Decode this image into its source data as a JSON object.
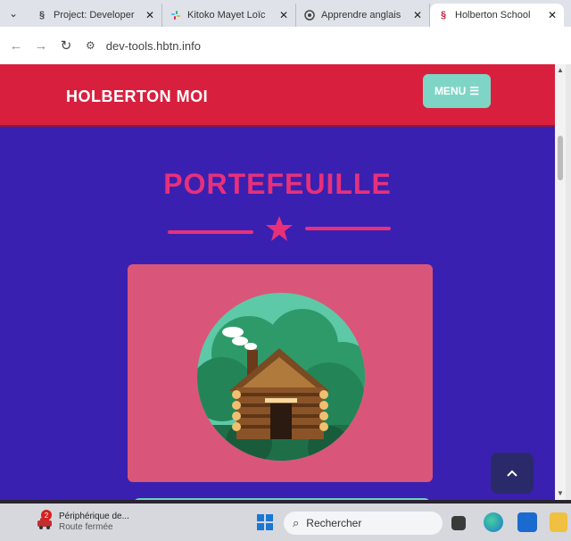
{
  "tabs": [
    {
      "title": "Project: Developer",
      "active": false
    },
    {
      "title": "Kitoko Mayet Loïc",
      "active": false
    },
    {
      "title": "Apprendre anglais",
      "active": false
    },
    {
      "title": "Holberton School",
      "active": true
    }
  ],
  "browser": {
    "url": "dev-tools.hbtn.info",
    "tab_list_icon": "chevron-down-icon"
  },
  "site": {
    "brand": "HOLBERTON MOI",
    "menu_label": "MENU",
    "section_title": "PORTEFEUILLE"
  },
  "taskbar": {
    "notification_title": "Périphérique de...",
    "notification_sub": "Route fermée",
    "notification_badge": "2",
    "search_placeholder": "Rechercher"
  },
  "colors": {
    "header": "#d8203e",
    "page_bg": "#3a20b0",
    "accent": "#e8307a",
    "menu_button": "#7fd5c5",
    "card": "#d9567a"
  }
}
